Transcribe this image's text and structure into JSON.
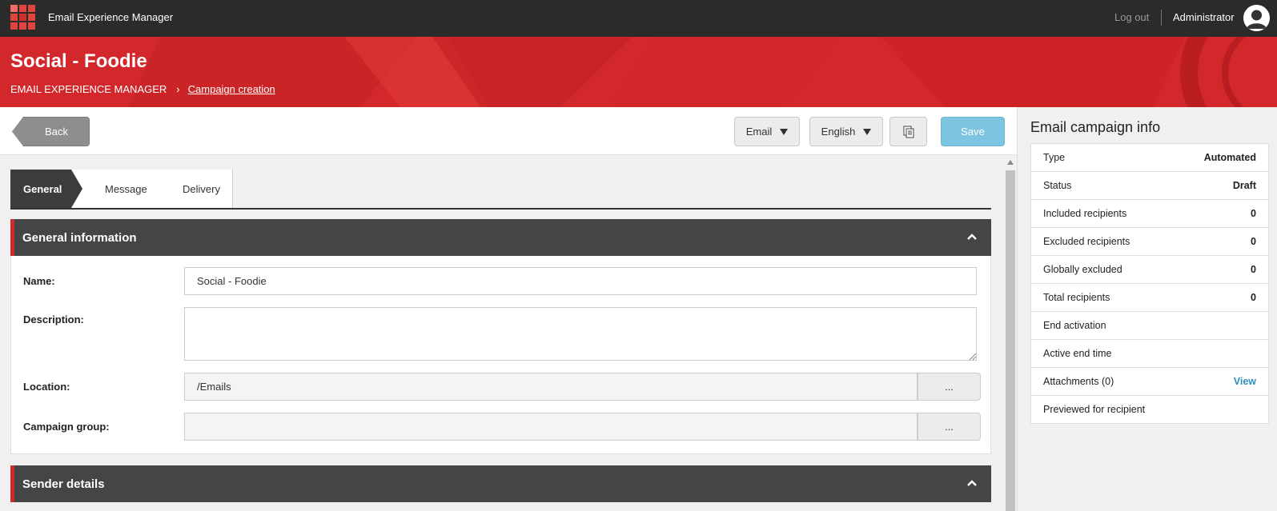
{
  "topbar": {
    "app_title": "Email Experience Manager",
    "logout": "Log out",
    "user": "Administrator"
  },
  "header": {
    "title": "Social - Foodie",
    "breadcrumb": {
      "root": "EMAIL EXPERIENCE MANAGER",
      "separator": "›",
      "current": "Campaign creation"
    }
  },
  "toolbar": {
    "back_label": "Back",
    "type_dropdown": "Email",
    "language_dropdown": "English",
    "save_label": "Save"
  },
  "tabs": [
    {
      "label": "General",
      "active": true
    },
    {
      "label": "Message",
      "active": false
    },
    {
      "label": "Delivery",
      "active": false
    }
  ],
  "general_info": {
    "heading": "General information",
    "fields": {
      "name_label": "Name:",
      "name_value": "Social - Foodie",
      "description_label": "Description:",
      "description_value": "",
      "location_label": "Location:",
      "location_value": "/Emails",
      "location_browse": "...",
      "campaign_group_label": "Campaign group:",
      "campaign_group_value": "",
      "campaign_group_browse": "..."
    }
  },
  "sender_details": {
    "heading": "Sender details"
  },
  "campaign_info": {
    "title": "Email campaign info",
    "rows": [
      {
        "label": "Type",
        "value": "Automated"
      },
      {
        "label": "Status",
        "value": "Draft"
      },
      {
        "label": "Included recipients",
        "value": "0"
      },
      {
        "label": "Excluded recipients",
        "value": "0"
      },
      {
        "label": "Globally excluded",
        "value": "0"
      },
      {
        "label": "Total recipients",
        "value": "0"
      },
      {
        "label": "End activation",
        "value": ""
      },
      {
        "label": "Active end time",
        "value": ""
      },
      {
        "label": "Attachments (0)",
        "value": "View"
      },
      {
        "label": "Previewed for recipient",
        "value": ""
      }
    ]
  },
  "colors": {
    "brand_red": "#d3282b",
    "topbar": "#2b2b2b",
    "section_header": "#454545",
    "save_button": "#7cc4df",
    "link": "#2a8fc0"
  }
}
